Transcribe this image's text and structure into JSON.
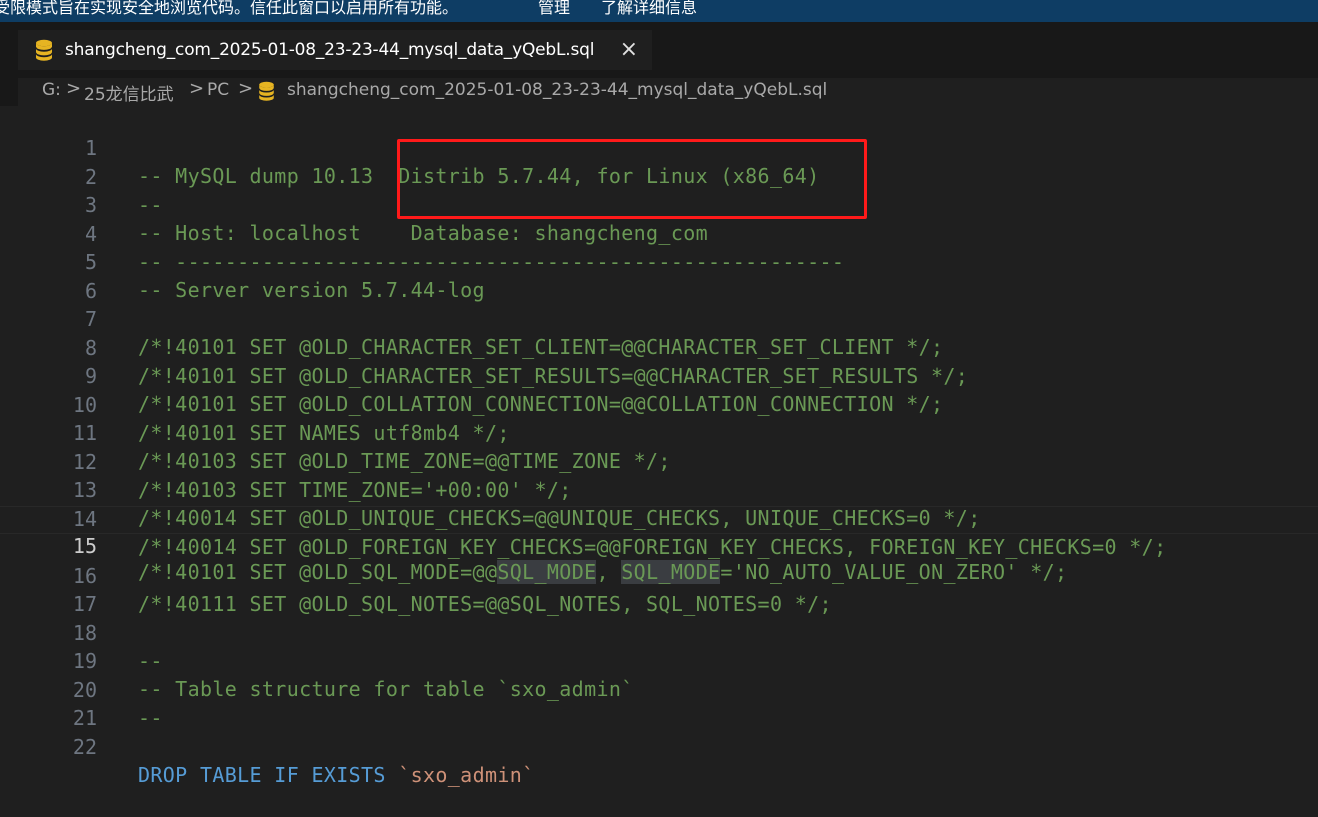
{
  "banner": {
    "message": "受限模式旨在实现安全地浏览代码。信任此窗口以启用所有功能。",
    "manage_link": "管理",
    "learn_more_link": "了解详细信息"
  },
  "tab": {
    "file_name": "shangcheng_com_2025-01-08_23-23-44_mysql_data_yQebL.sql",
    "close_icon": "×"
  },
  "breadcrumb": {
    "drive": "G:",
    "folder1": "25龙信比武",
    "folder2": "PC",
    "file": "shangcheng_com_2025-01-08_23-23-44_mysql_data_yQebL.sql",
    "separator": ">"
  },
  "editor": {
    "current_line": 15,
    "lines": [
      {
        "n": "1",
        "text": "-- MySQL dump 10.13  Distrib 5.7.44, for Linux (x86_64)"
      },
      {
        "n": "2",
        "text": "--"
      },
      {
        "n": "3",
        "text": "-- Host: localhost    Database: shangcheng_com"
      },
      {
        "n": "4",
        "text": "-- ------------------------------------------------------"
      },
      {
        "n": "5",
        "text": "-- Server version 5.7.44-log"
      },
      {
        "n": "6",
        "text": ""
      },
      {
        "n": "7",
        "text": "/*!40101 SET @OLD_CHARACTER_SET_CLIENT=@@CHARACTER_SET_CLIENT */;"
      },
      {
        "n": "8",
        "text": "/*!40101 SET @OLD_CHARACTER_SET_RESULTS=@@CHARACTER_SET_RESULTS */;"
      },
      {
        "n": "9",
        "text": "/*!40101 SET @OLD_COLLATION_CONNECTION=@@COLLATION_CONNECTION */;"
      },
      {
        "n": "10",
        "text": "/*!40101 SET NAMES utf8mb4 */;"
      },
      {
        "n": "11",
        "text": "/*!40103 SET @OLD_TIME_ZONE=@@TIME_ZONE */;"
      },
      {
        "n": "12",
        "text": "/*!40103 SET TIME_ZONE='+00:00' */;"
      },
      {
        "n": "13",
        "text": "/*!40014 SET @OLD_UNIQUE_CHECKS=@@UNIQUE_CHECKS, UNIQUE_CHECKS=0 */;"
      },
      {
        "n": "14",
        "text": "/*!40014 SET @OLD_FOREIGN_KEY_CHECKS=@@FOREIGN_KEY_CHECKS, FOREIGN_KEY_CHECKS=0 */;"
      },
      {
        "n": "15",
        "pre": "/*!40101 SET @OLD_SQL_MODE=@@",
        "hl1": "SQL_MODE",
        "mid": ", ",
        "hl2": "SQL_MODE",
        "post": "='NO_AUTO_VALUE_ON_ZERO' */;"
      },
      {
        "n": "16",
        "text": "/*!40111 SET @OLD_SQL_NOTES=@@SQL_NOTES, SQL_NOTES=0 */;"
      },
      {
        "n": "17",
        "text": ""
      },
      {
        "n": "18",
        "text": "--"
      },
      {
        "n": "19",
        "text": "-- Table structure for table `sxo_admin`"
      },
      {
        "n": "20",
        "text": "--"
      },
      {
        "n": "21",
        "text": ""
      },
      {
        "n": "22",
        "kw": "DROP TABLE IF EXISTS ",
        "str": "`sxo_admin`"
      }
    ]
  },
  "colors": {
    "comment": "#6a9955",
    "keyword": "#569cd6",
    "string": "#ce9178",
    "highlight_box": "#ff1a1a",
    "banner_bg": "#0e3d64"
  },
  "icons": {
    "file_type": "database-icon",
    "close": "close-icon",
    "chevron": "chevron-right-icon"
  }
}
